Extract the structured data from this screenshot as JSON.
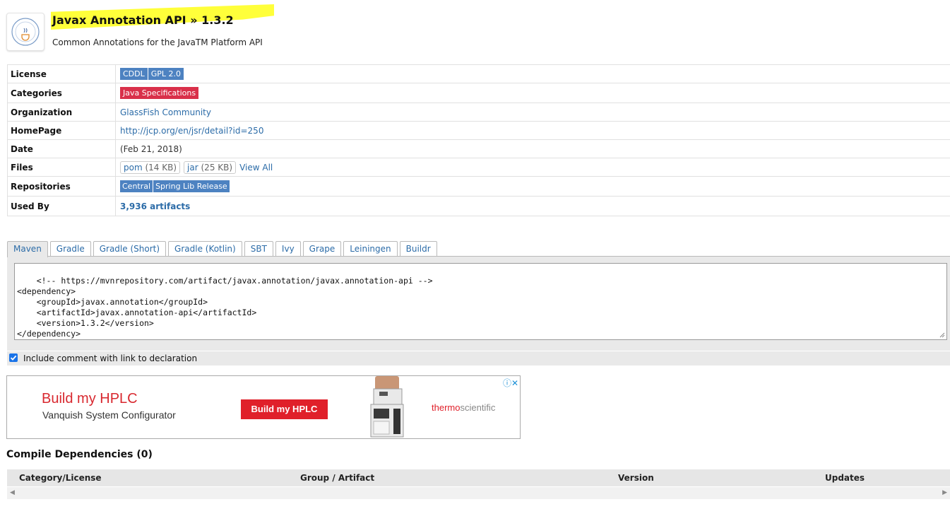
{
  "header": {
    "title": "Javax Annotation API",
    "separator": "»",
    "version": "1.3.2",
    "subtitle": "Common Annotations for the JavaTM Platform API"
  },
  "info": {
    "license": {
      "label": "License",
      "values": [
        "CDDL",
        "GPL 2.0"
      ]
    },
    "categories": {
      "label": "Categories",
      "value": "Java Specifications"
    },
    "organization": {
      "label": "Organization",
      "value": "GlassFish Community"
    },
    "homepage": {
      "label": "HomePage",
      "value": "http://jcp.org/en/jsr/detail?id=250"
    },
    "date": {
      "label": "Date",
      "value": "(Feb 21, 2018)"
    },
    "files": {
      "label": "Files",
      "items": [
        {
          "name": "pom",
          "size": "(14 KB)"
        },
        {
          "name": "jar",
          "size": "(25 KB)"
        }
      ],
      "view_all": "View All"
    },
    "repositories": {
      "label": "Repositories",
      "values": [
        "Central",
        "Spring Lib Release"
      ]
    },
    "used_by": {
      "label": "Used By",
      "value": "3,936 artifacts"
    }
  },
  "tabs": [
    "Maven",
    "Gradle",
    "Gradle (Short)",
    "Gradle (Kotlin)",
    "SBT",
    "Ivy",
    "Grape",
    "Leiningen",
    "Buildr"
  ],
  "active_tab": "Maven",
  "code": "<!-- https://mvnrepository.com/artifact/javax.annotation/javax.annotation-api -->\n<dependency>\n    <groupId>javax.annotation</groupId>\n    <artifactId>javax.annotation-api</artifactId>\n    <version>1.3.2</version>\n</dependency>",
  "include_comment": {
    "label": "Include comment with link to declaration",
    "checked": true
  },
  "ad": {
    "title": "Build my HPLC",
    "subtitle": "Vanquish System Configurator",
    "button": "Build my HPLC",
    "brand_bold": "thermo",
    "brand_light": "scientific",
    "icons": "ⓘ✕"
  },
  "deps": {
    "title": "Compile Dependencies (0)",
    "columns": [
      "Category/License",
      "Group / Artifact",
      "Version",
      "Updates"
    ]
  },
  "colors": {
    "license_badge": "#4d82c1",
    "category_badge": "#d9304a",
    "link": "#2c6ca8",
    "highlight": "#ffff3a",
    "ad_red": "#e0202a"
  }
}
